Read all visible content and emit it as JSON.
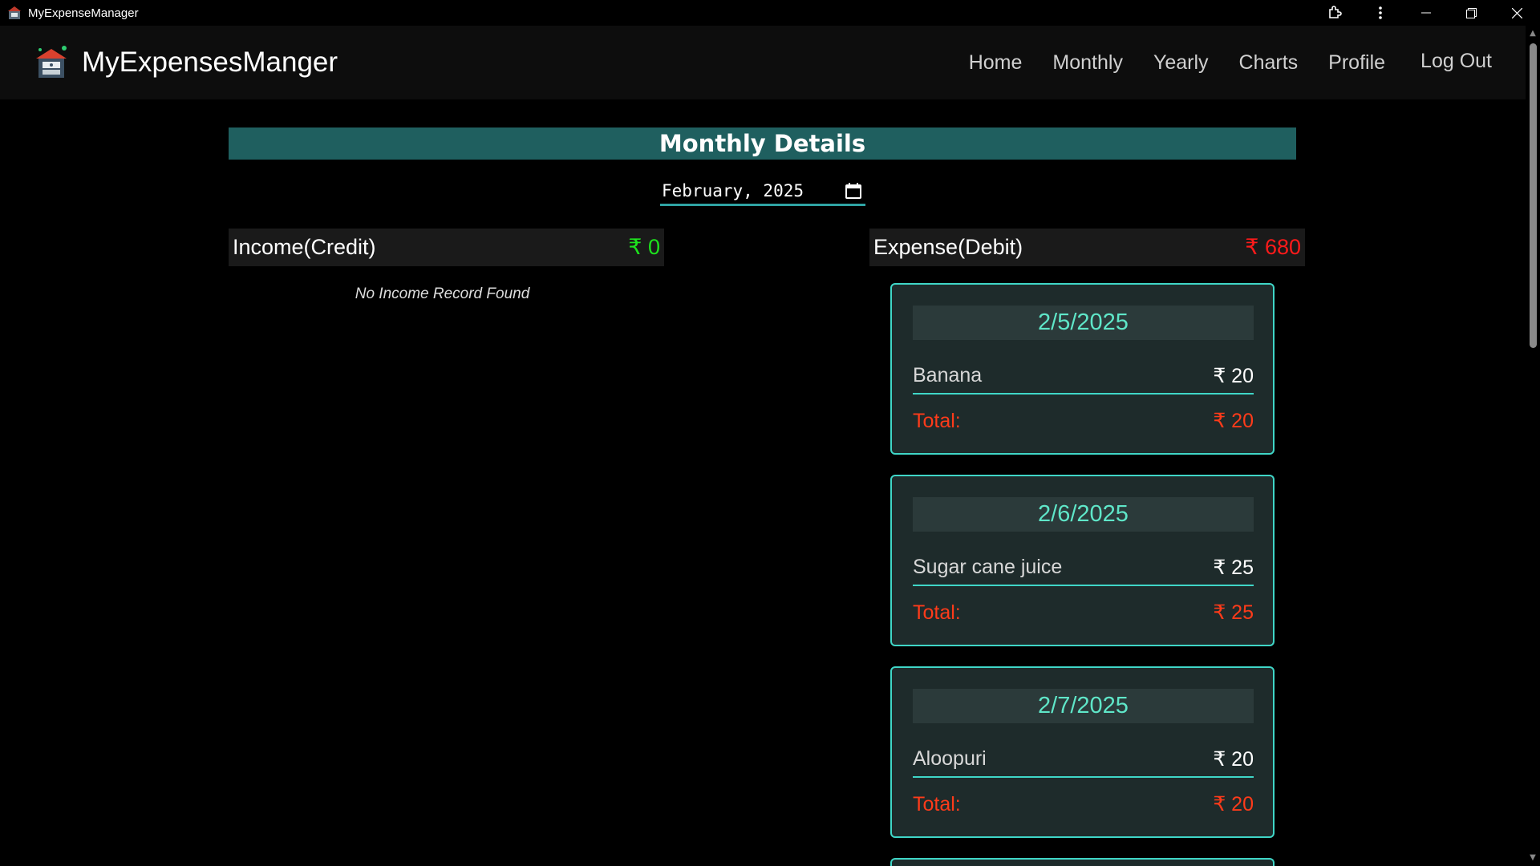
{
  "window": {
    "title": "MyExpenseManager",
    "icons": [
      "app-icon",
      "extensions-icon",
      "more-icon",
      "minimize-icon",
      "restore-icon",
      "close-icon"
    ]
  },
  "navbar": {
    "brand": "MyExpensesManger",
    "links": [
      "Home",
      "Monthly",
      "Yearly",
      "Charts",
      "Profile"
    ],
    "logout": "Log Out"
  },
  "main": {
    "heading": "Monthly Details",
    "month": "February, 2025",
    "currency": "₹",
    "income": {
      "label": "Income(Credit)",
      "amount": "₹ 0",
      "empty_message": "No Income Record Found"
    },
    "expense": {
      "label": "Expense(Debit)",
      "amount": "₹ 680"
    },
    "days": [
      {
        "date": "2/5/2025",
        "item": "Banana",
        "item_amount": "₹ 20",
        "total_label": "Total:",
        "total": "₹ 20"
      },
      {
        "date": "2/6/2025",
        "item": "Sugar cane juice",
        "item_amount": "₹ 25",
        "total_label": "Total:",
        "total": "₹ 25"
      },
      {
        "date": "2/7/2025",
        "item": "Aloopuri",
        "item_amount": "₹ 20",
        "total_label": "Total:",
        "total": "₹ 20"
      }
    ]
  },
  "colors": {
    "heading_bg": "#1f5f5f",
    "income_amount": "#1de21d",
    "expense_amount": "#ff1a1a",
    "card_border": "#3fd6c7",
    "card_date": "#5fe6c8",
    "total": "#ff3b1a"
  }
}
